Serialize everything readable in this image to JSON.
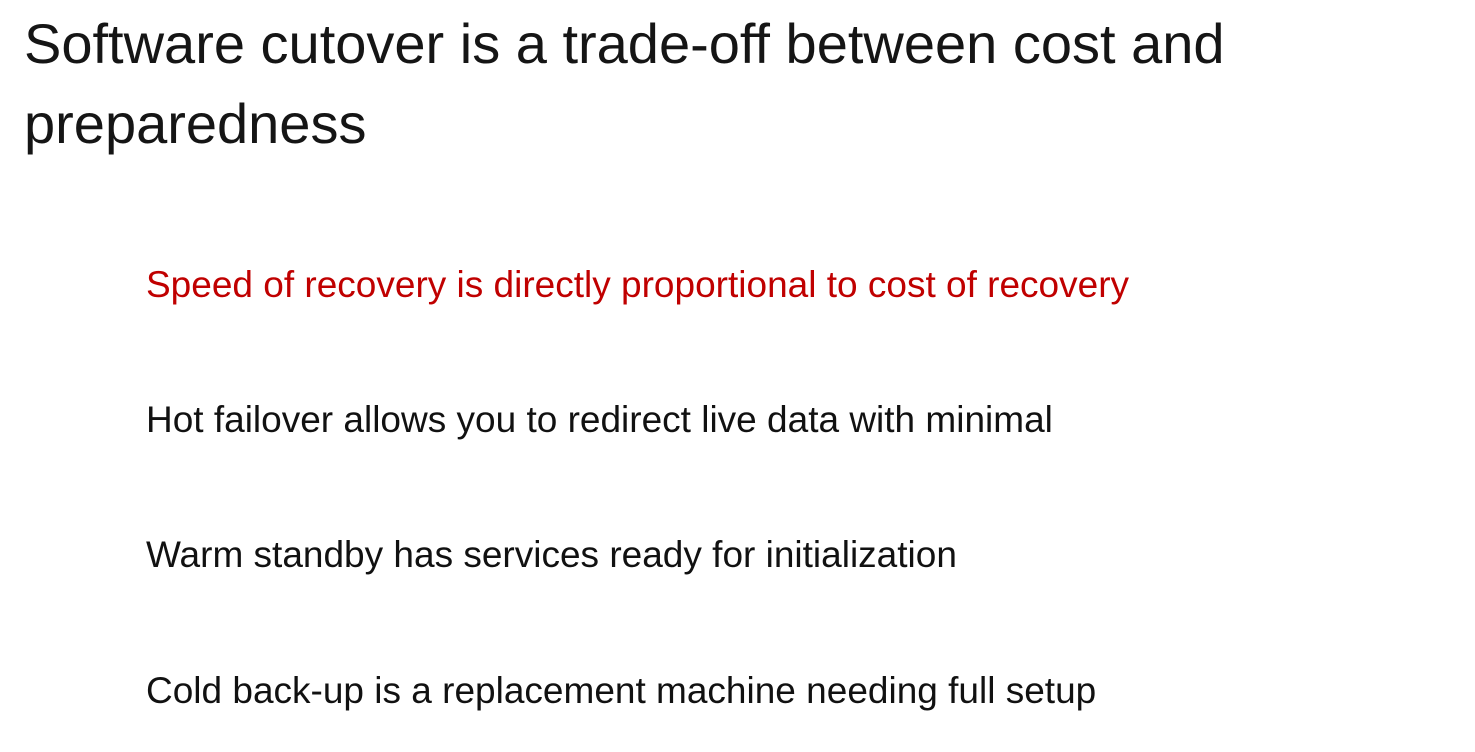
{
  "slide": {
    "title_lines": [
      "Software cutover is a trade-off between cost and",
      "preparedness"
    ],
    "bullets": [
      "Speed of recovery is directly proportional to cost of recovery",
      "Hot failover allows you to redirect live data with minimal",
      "Warm standby has services ready for initialization",
      "Cold back-up is a replacement machine needing full setup"
    ],
    "colors": {
      "background": "#ffffff",
      "title_text": "#151515",
      "body_text": "#111111",
      "highlight_text": "#c00000"
    }
  }
}
